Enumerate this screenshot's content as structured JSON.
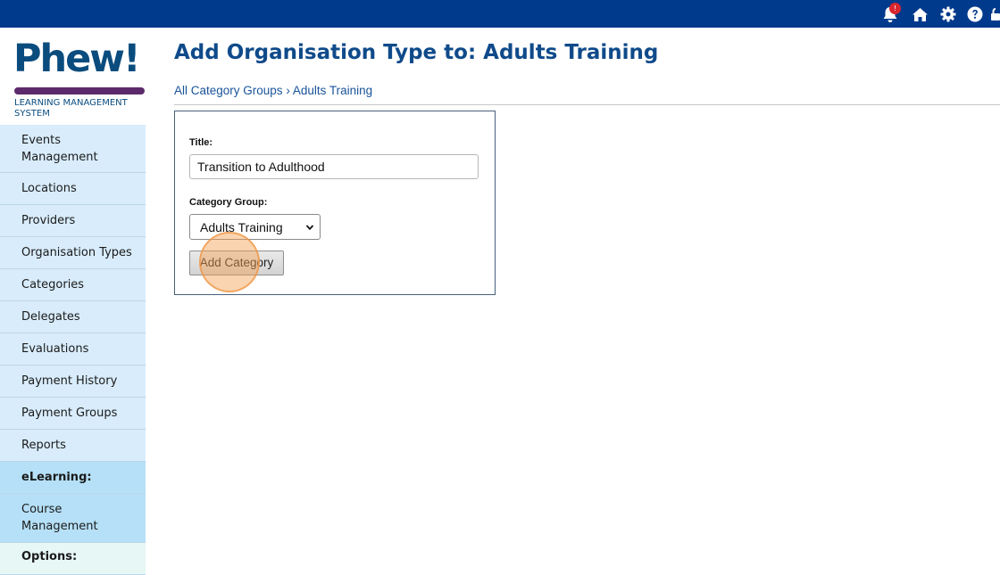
{
  "topbar": {
    "notification_count": "!",
    "icons": [
      "bell-icon",
      "home-icon",
      "gear-icon",
      "help-icon",
      "lock-icon"
    ]
  },
  "logo": {
    "word": "Phew!",
    "subtitle": "LEARNING MANAGEMENT SYSTEM"
  },
  "sidebar": {
    "items": [
      {
        "label": "Events Management"
      },
      {
        "label": "Locations"
      },
      {
        "label": "Providers"
      },
      {
        "label": "Organisation Types"
      },
      {
        "label": "Categories"
      },
      {
        "label": "Delegates"
      },
      {
        "label": "Evaluations"
      },
      {
        "label": "Payment History"
      },
      {
        "label": "Payment Groups"
      },
      {
        "label": "Reports"
      }
    ],
    "elearning_heading": "eLearning:",
    "course_management": "Course Management",
    "options_heading": "Options:"
  },
  "page": {
    "title": "Add Organisation Type to: Adults Training",
    "breadcrumb": {
      "root": "All Category Groups",
      "separator": "›",
      "current": "Adults Training"
    }
  },
  "form": {
    "title_label": "Title:",
    "title_value": "Transition to Adulthood",
    "group_label": "Category Group:",
    "group_selected": "Adults Training",
    "submit_label": "Add Category"
  },
  "colors": {
    "topbar": "#003a8c",
    "heading": "#0f4a8a",
    "sidebar_item": "#d8ecfb",
    "sidebar_section": "#b5e0f7",
    "logo_text": "#0b4c7e",
    "logo_bar": "#5c2a6b"
  }
}
